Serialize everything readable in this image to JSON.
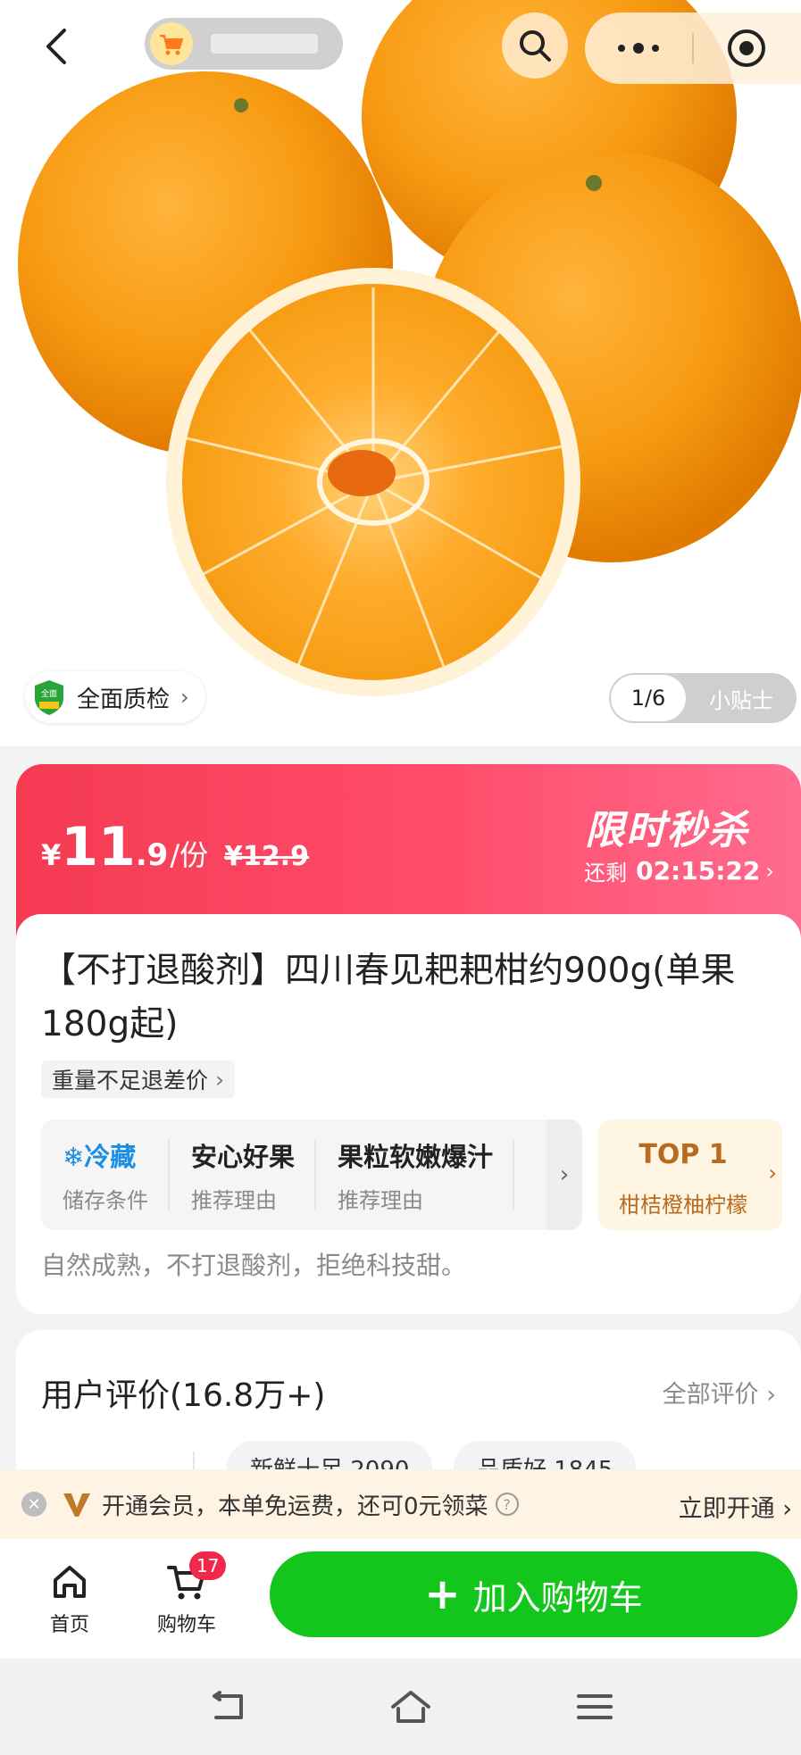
{
  "topbar": {
    "back_icon": "chevron-left-icon",
    "shop_icon": "cart-logo-icon",
    "shop_name": "",
    "search_icon": "search-icon",
    "more_icon": "more-dots-icon",
    "close_icon": "target-close-icon"
  },
  "gallery": {
    "quality_badge": "全面质检",
    "current_index": "1/6",
    "tip_label": "小贴士"
  },
  "flash_sale": {
    "currency": "¥",
    "price_int": "11",
    "price_dec": ".9",
    "unit": "/份",
    "original_price": "¥12.9",
    "title": "限时秒杀",
    "remaining_label": "还剩",
    "countdown": "02:15:22",
    "accent_color": "#f53a52"
  },
  "product": {
    "title": "【不打退酸剂】四川春见耙耙柑约900g(单果180g起)",
    "weight_tag": "重量不足退差价",
    "attributes": [
      {
        "main": "❄冷藏",
        "sub": "储存条件"
      },
      {
        "main": "安心好果",
        "sub": "推荐理由"
      },
      {
        "main": "果粒软嫩爆汁",
        "sub": "推荐理由"
      }
    ],
    "rank_top": "TOP 1",
    "rank_sub": "柑桔橙柚柠檬",
    "description": "自然成熟，不打退酸剂，拒绝科技甜。"
  },
  "reviews": {
    "title": "用户评价(16.8万+)",
    "all_label": "全部评价",
    "chips": [
      "新鲜十足 2090",
      "品质好 1845"
    ]
  },
  "member_bar": {
    "text": "开通会员，本单免运费，还可0元领菜",
    "open_label": "立即开通"
  },
  "bottom_bar": {
    "home_label": "首页",
    "cart_label": "购物车",
    "cart_count": "17",
    "add_to_cart": "加入购物车",
    "button_color": "#13c61b"
  }
}
